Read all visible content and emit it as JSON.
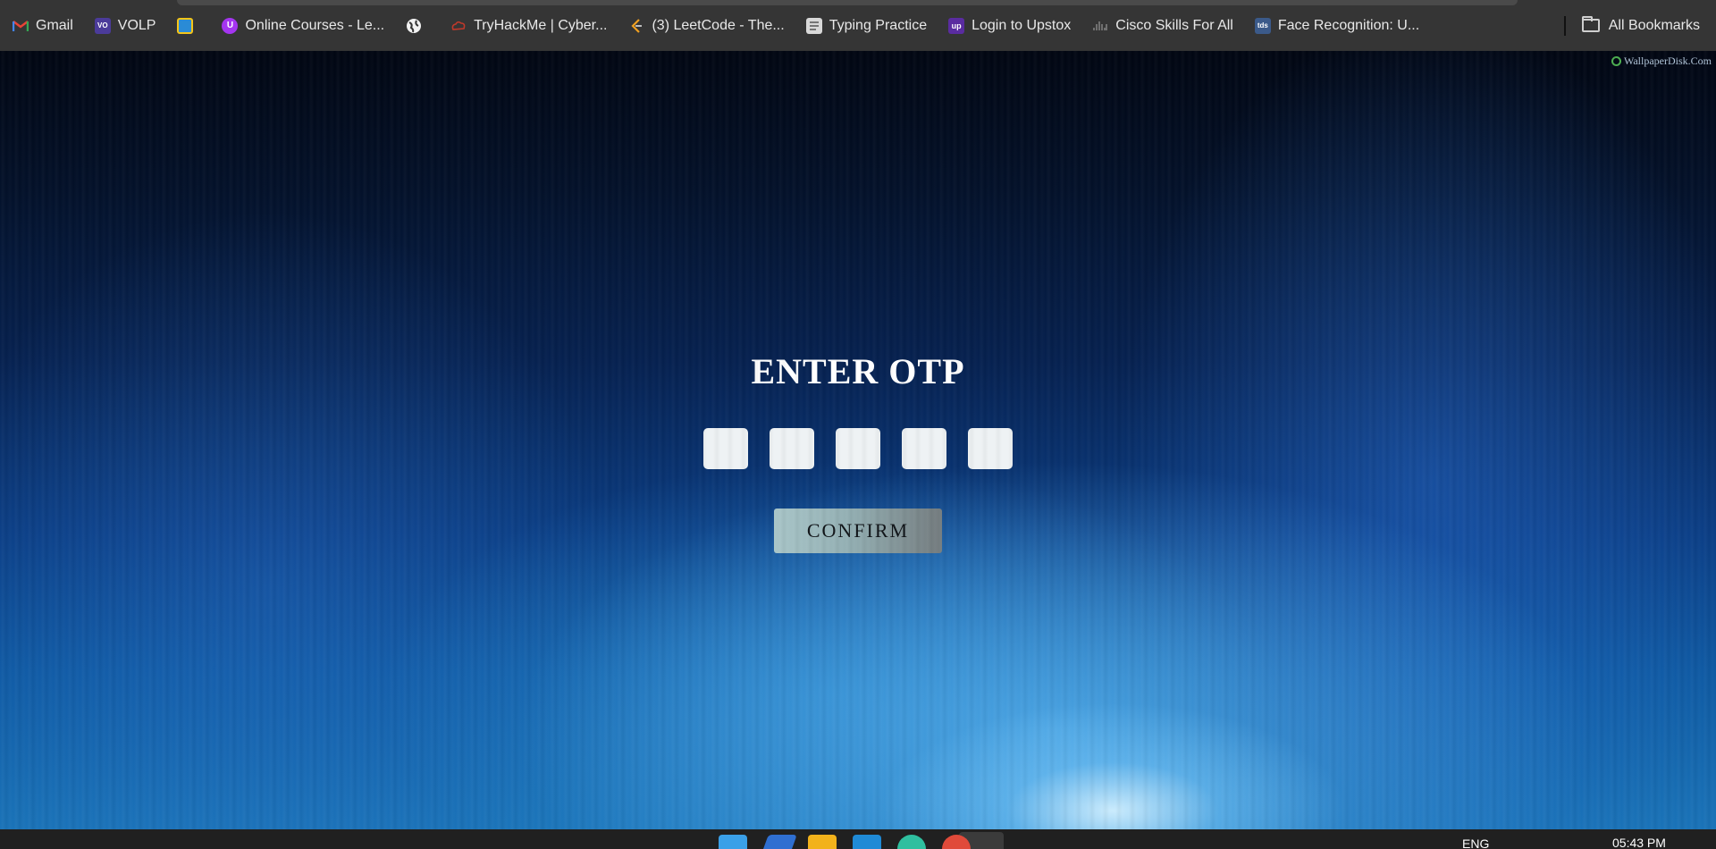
{
  "bookmarks": [
    {
      "label": "Gmail",
      "icon": "gmail-icon",
      "color": "#ea4335"
    },
    {
      "label": "VOLP",
      "icon": "volp-icon",
      "color": "#4b3b9a"
    },
    {
      "label": "",
      "icon": "course-app-icon",
      "color": "#2a8bd6"
    },
    {
      "label": "Online Courses - Le...",
      "icon": "udemy-icon",
      "color": "#a435f0"
    },
    {
      "label": "",
      "icon": "globe-icon",
      "color": "#ffffff"
    },
    {
      "label": "TryHackMe | Cyber...",
      "icon": "tryhackme-icon",
      "color": "#c0392b"
    },
    {
      "label": "(3) LeetCode - The...",
      "icon": "leetcode-icon",
      "color": "#f0a020"
    },
    {
      "label": "Typing Practice",
      "icon": "typing-icon",
      "color": "#bdbdbd"
    },
    {
      "label": "Login to Upstox",
      "icon": "upstox-icon",
      "color": "#5a2ca0"
    },
    {
      "label": "Cisco Skills For All",
      "icon": "cisco-icon",
      "color": "#8a8a8a"
    },
    {
      "label": "Face Recognition: U...",
      "icon": "tds-icon",
      "color": "#3b5a8a"
    }
  ],
  "all_bookmarks_label": "All Bookmarks",
  "watermark": "WallpaperDisk.Com",
  "otp": {
    "title": "ENTER OTP",
    "digit_count": 5,
    "values": [
      "",
      "",
      "",
      "",
      ""
    ],
    "confirm_label": "CONFIRM"
  },
  "taskbar": {
    "language": "ENG",
    "time": "05:43 PM"
  }
}
